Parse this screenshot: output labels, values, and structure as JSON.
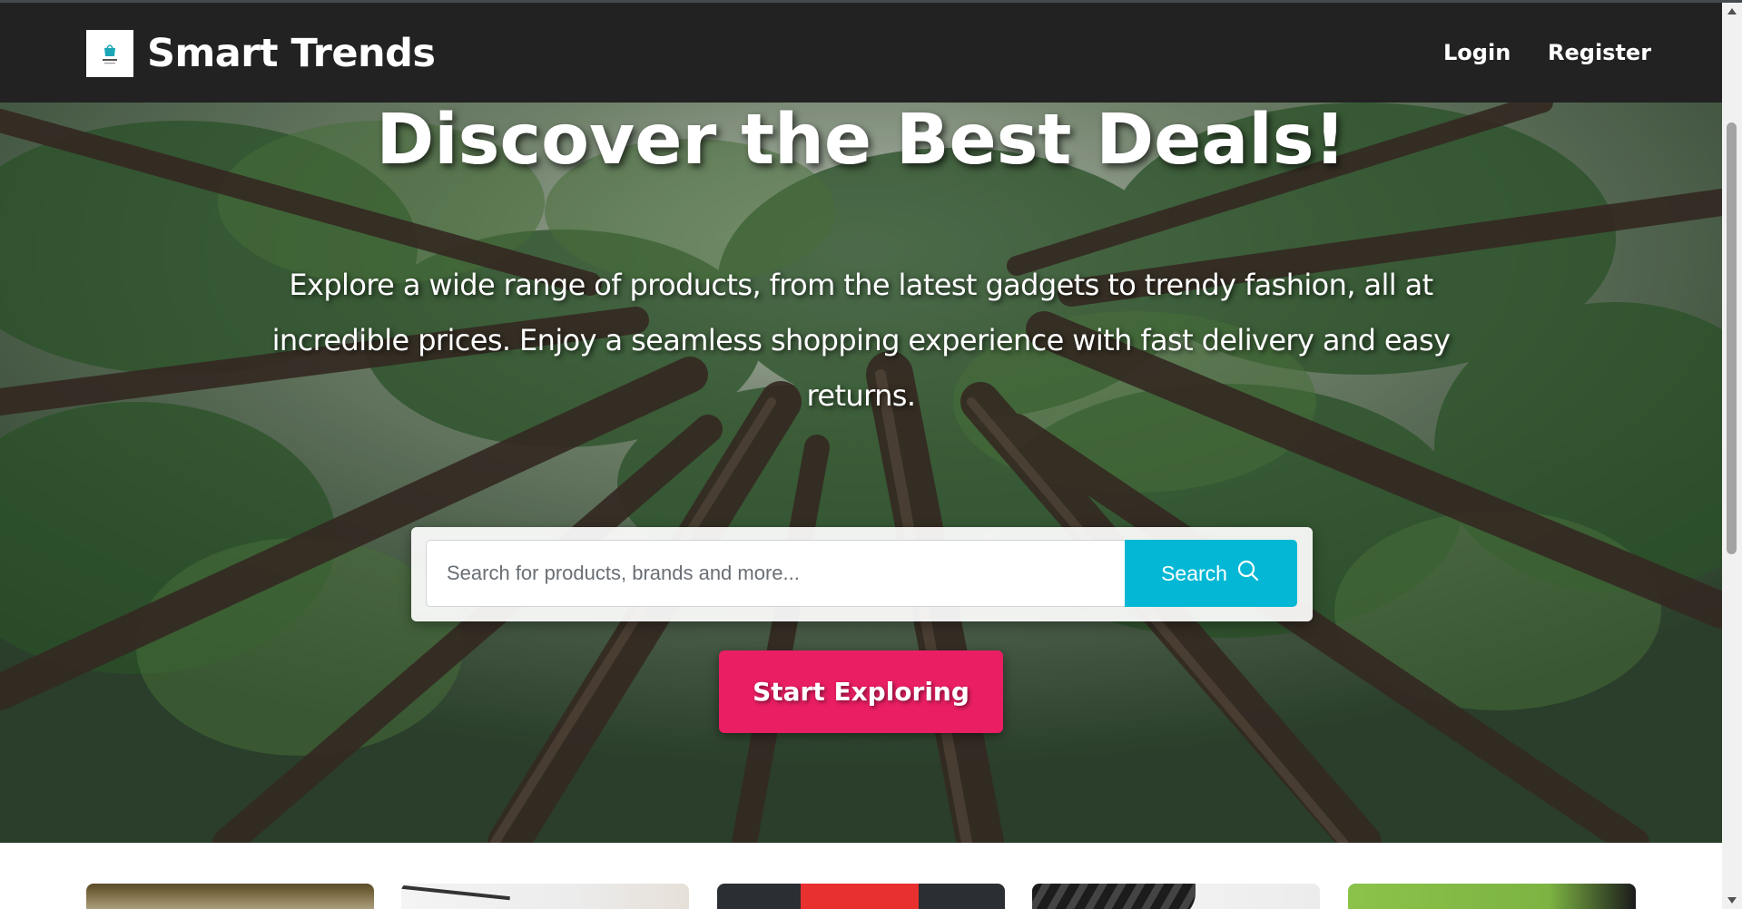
{
  "navbar": {
    "brand": "Smart Trends",
    "logo_icon": "shopping-bag-logo",
    "links": [
      {
        "label": "Login"
      },
      {
        "label": "Register"
      }
    ]
  },
  "hero": {
    "title": "Discover the Best Deals!",
    "description": "Explore a wide range of products, from the latest gadgets to trendy fashion, all at incredible prices. Enjoy a seamless shopping experience with fast delivery and easy returns.",
    "background": "forest canopy photo",
    "search": {
      "placeholder": "Search for products, brands and more...",
      "value": "",
      "button_label": "Search",
      "button_icon": "search-icon"
    },
    "cta_label": "Start Exploring"
  },
  "colors": {
    "navbar_bg": "#222222",
    "search_button": "#04b8d5",
    "cta_button": "#e91e63"
  }
}
